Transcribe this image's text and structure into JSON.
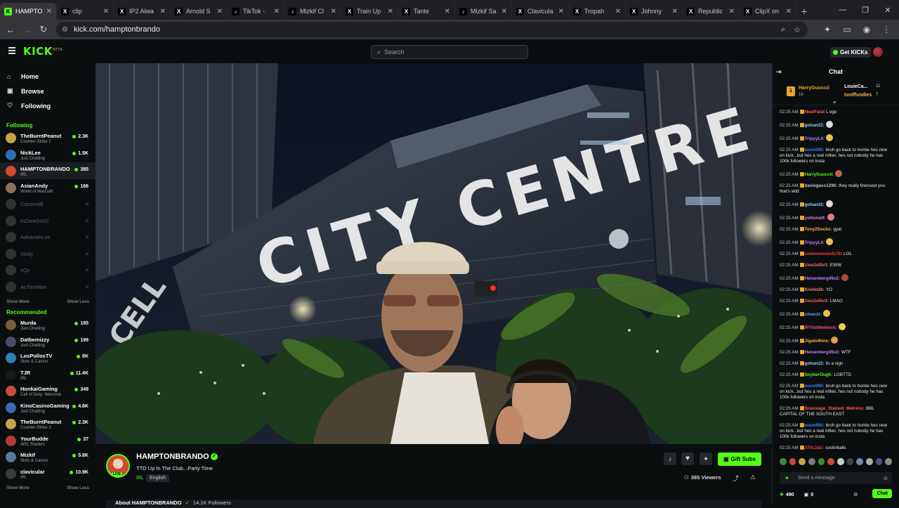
{
  "tabs": [
    {
      "title": "HAMPTO",
      "favicon": "K",
      "color": "#53fc18",
      "active": true
    },
    {
      "title": "clip",
      "favicon": "X",
      "color": "#ffffff"
    },
    {
      "title": "IP2 Alwa",
      "favicon": "X",
      "color": "#ffffff"
    },
    {
      "title": "Arnold S",
      "favicon": "X",
      "color": "#ffffff"
    },
    {
      "title": "TikTok -",
      "favicon": "♪",
      "color": "#ffffff"
    },
    {
      "title": "Mizkif Cl",
      "favicon": "♪",
      "color": "#ffffff"
    },
    {
      "title": "Train Up",
      "favicon": "X",
      "color": "#ffffff"
    },
    {
      "title": "Tante",
      "favicon": "X",
      "color": "#ffffff"
    },
    {
      "title": "Mizkif Sa",
      "favicon": "♪",
      "color": "#ffffff"
    },
    {
      "title": "Clavicula",
      "favicon": "X",
      "color": "#ffffff"
    },
    {
      "title": "Tropah",
      "favicon": "X",
      "color": "#ffffff"
    },
    {
      "title": "Johnny",
      "favicon": "X",
      "color": "#ffffff"
    },
    {
      "title": "Republic",
      "favicon": "X",
      "color": "#ffffff"
    },
    {
      "title": "ClipX on",
      "favicon": "X",
      "color": "#ffffff"
    }
  ],
  "browser": {
    "url": "kick.com/hamptonbrando",
    "new_tab": "+",
    "minimize": "—",
    "restore": "❐",
    "close": "✕"
  },
  "topnav": {
    "logo": "KICK",
    "logo_sup": "BETA",
    "search_placeholder": "Search",
    "get_kicks": "Get KICKs"
  },
  "sidebar": {
    "nav": [
      {
        "label": "Home",
        "icon": "home-icon",
        "glyph": "⌂"
      },
      {
        "label": "Browse",
        "icon": "browse-icon",
        "glyph": "▣"
      },
      {
        "label": "Following",
        "icon": "heart-icon",
        "glyph": "♡"
      }
    ],
    "following_title": "Following",
    "following": [
      {
        "name": "TheBurntPeanut",
        "category": "Counter-Strike 2",
        "viewers": "2.3K",
        "color": "#c8a24a",
        "live": true
      },
      {
        "name": "NickLee",
        "category": "Just Chatting",
        "viewers": "1.5K",
        "color": "#2b6fb3",
        "live": true
      },
      {
        "name": "HAMPTONBRANDO",
        "category": "IRL",
        "viewers": "385",
        "color": "#cf4a2f",
        "live": true,
        "selected": true
      },
      {
        "name": "AsianAndy",
        "category": "World of Warcraft",
        "viewers": "166",
        "color": "#8b6e5a",
        "live": true
      },
      {
        "name": "CoconutB",
        "color": "#777777",
        "live": false
      },
      {
        "name": "InZane0420",
        "color": "#777777",
        "live": false
      },
      {
        "name": "AdrianahLee",
        "color": "#777777",
        "live": false
      },
      {
        "name": "Vitaly",
        "color": "#777777",
        "live": false
      },
      {
        "name": "xQc",
        "color": "#777777",
        "live": false
      },
      {
        "name": "AcTionMan",
        "color": "#777777",
        "live": false
      }
    ],
    "show_more": "Show More",
    "show_less": "Show Less",
    "recommended_title": "Recommended",
    "recommended": [
      {
        "name": "Murda",
        "category": "Just Chatting",
        "viewers": "185",
        "color": "#7a5a3a"
      },
      {
        "name": "Datbemizzy",
        "category": "Just Chatting",
        "viewers": "199",
        "color": "#4a4a6a"
      },
      {
        "name": "LosPollosTV",
        "category": "Slots & Casino",
        "viewers": "8K",
        "color": "#2f7fb3"
      },
      {
        "name": "TJR",
        "category": "IRL",
        "viewers": "11.4K",
        "color": "#1a1a1a"
      },
      {
        "name": "HonkaiGaming",
        "category": "Call of Duty: Warzone",
        "viewers": "349",
        "color": "#c84a3a"
      },
      {
        "name": "KinoCasinoGaming",
        "category": "Just Chatting",
        "viewers": "4.6K",
        "color": "#3a6ab3"
      },
      {
        "name": "TheBurntPeanut",
        "category": "Counter-Strike 2",
        "viewers": "2.3K",
        "color": "#c8a24a"
      },
      {
        "name": "YourBudde",
        "category": "ARC Raiders",
        "viewers": "37",
        "color": "#b33a3a"
      },
      {
        "name": "Mizkif",
        "category": "Slots & Casino",
        "viewers": "5.8K",
        "color": "#5a7a9a"
      },
      {
        "name": "clavicular",
        "category": "IRL",
        "viewers": "10.9K",
        "color": "#3a3a3a"
      }
    ]
  },
  "stream": {
    "sign_letters": "CITY CENTRE",
    "sign_side": "CELL",
    "streamer": "HAMPTONBRANDO",
    "title": "TTD Up In The Club...Party Time",
    "category": "IRL",
    "language": "English",
    "live": "LIVE",
    "viewers": "385 Viewers",
    "gift_subs": "Gift Subs",
    "about_label": "About HAMPTONBRANDO",
    "followers": "14.1K Followers"
  },
  "chat": {
    "title": "Chat",
    "pinned": [
      {
        "user": "HarryGuuccii",
        "sub": "16",
        "rank": "1"
      },
      {
        "user": "LouieCa...",
        "count": "11"
      },
      {
        "user": "Isniffundies",
        "count": "7"
      }
    ],
    "messages": [
      {
        "time": "02:25 AM",
        "user": "NeatFatal",
        "color": "#ff5a5a",
        "text": "L ego"
      },
      {
        "time": "02:25 AM",
        "user": "gohan22:",
        "color": "#8fd1ff",
        "text": "",
        "emote": "#d9d9d9"
      },
      {
        "time": "02:25 AM",
        "user": "TrippyLit:",
        "color": "#c27aff",
        "text": "",
        "emote": "#e8c34a"
      },
      {
        "time": "02:25 AM",
        "user": "wave990:",
        "color": "#3b7bff",
        "text": "bruh go back to homie hes new on kick...but hes a real mfker, hes not nobody he has 100k followers on insta"
      },
      {
        "time": "02:25 AM",
        "user": "HarryGuuccii:",
        "color": "#53fc18",
        "text": "",
        "emote": "#c0615a"
      },
      {
        "time": "02:25 AM",
        "user": "daviegass1296:",
        "color": "#c2c2c2",
        "text": "they really finessed you that's wild"
      },
      {
        "time": "02:25 AM",
        "user": "gohan22:",
        "color": "#8fd1ff",
        "text": "",
        "emote": "#d9d9d9"
      },
      {
        "time": "02:25 AM",
        "user": "yoitsmatt:",
        "color": "#e57aff",
        "text": "",
        "emote": "#e87a8a"
      },
      {
        "time": "02:25 AM",
        "user": "Tony2Socks:",
        "color": "#ffb347",
        "text": "gyat"
      },
      {
        "time": "02:25 AM",
        "user": "TrippyLit:",
        "color": "#c27aff",
        "text": "",
        "emote": "#e8c34a"
      },
      {
        "time": "02:25 AM",
        "user": "sistermonsiefx78:",
        "color": "#ff3b3b",
        "text": "LOL"
      },
      {
        "time": "02:25 AM",
        "user": "1lou1el0v3:",
        "color": "#ff6b6b",
        "text": "EWW"
      },
      {
        "time": "02:25 AM",
        "user": "Heisenberg45x2:",
        "color": "#c77dff",
        "text": "",
        "emote": "#b34a3a"
      },
      {
        "time": "02:25 AM",
        "user": "Kishin2k:",
        "color": "#ff7a7a",
        "text": "YO"
      },
      {
        "time": "02:25 AM",
        "user": "1lou1el0v3:",
        "color": "#ff6b6b",
        "text": "LMAO"
      },
      {
        "time": "02:25 AM",
        "user": "cmaszz:",
        "color": "#6aa8ff",
        "text": "",
        "emote": "#e8c34a"
      },
      {
        "time": "02:25 AM",
        "user": "IP7dotNetwork:",
        "color": "#ff4a8a",
        "text": "",
        "emote": "#e8d34a"
      },
      {
        "time": "02:25 AM",
        "user": "Jigalo4hire:",
        "color": "#ffb347",
        "text": "",
        "emote": "#d9a24a"
      },
      {
        "time": "02:25 AM",
        "user": "Heisenberg45x2:",
        "color": "#c77dff",
        "text": "WTF"
      },
      {
        "time": "02:25 AM",
        "user": "gohan22:",
        "color": "#8fd1ff",
        "text": "its a sign"
      },
      {
        "time": "02:25 AM",
        "user": "SoyberOugh:",
        "color": "#53fc18",
        "text": "LGBTTD"
      },
      {
        "time": "02:25 AM",
        "user": "wave990:",
        "color": "#3b7bff",
        "text": "bruh go back to homie hes new on kick...but hes a real mfker, hes not nobody he has 100k followers on insta"
      },
      {
        "time": "02:25 AM",
        "user": "Snausage_Stained_Matress:",
        "color": "#ff5a5a",
        "text": "BBL CAPITAL OF THE SOUTH EAST"
      },
      {
        "time": "02:25 AM",
        "user": "wave990:",
        "color": "#3b7bff",
        "text": "bruh go back to homie hes new on kick...but hes a real mfker, hes not nobody he has 100k followers on insta"
      },
      {
        "time": "02:25 AM",
        "user": "370zJalz:",
        "color": "#ff3b3b",
        "text": "cocknballs"
      }
    ],
    "input_placeholder": "Send a message",
    "points": "490",
    "gifts": "0",
    "send_label": "Chat"
  },
  "colors": {
    "accent": "#53fc18",
    "bg": "#0b0e0f",
    "panel": "#191b1f"
  }
}
